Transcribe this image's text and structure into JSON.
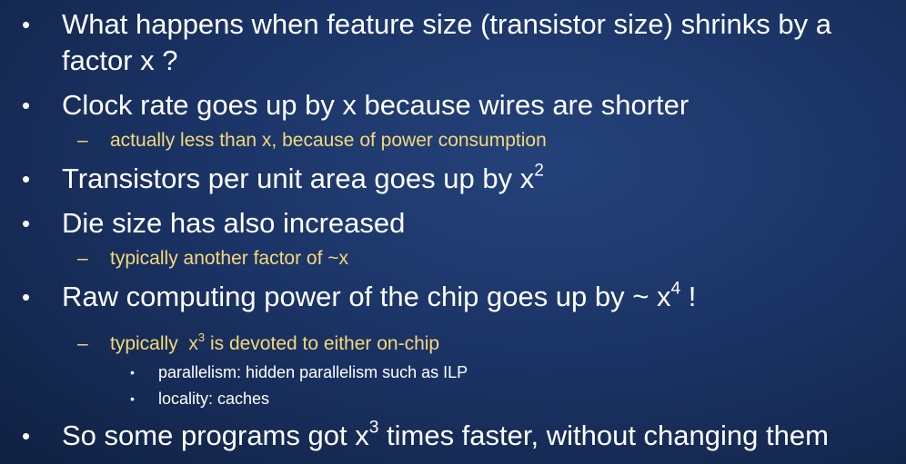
{
  "bullets": {
    "b1": {
      "marker": "•",
      "text": "What happens when feature size (transistor size) shrinks by a factor x ?"
    },
    "b2": {
      "marker": "•",
      "text": "Clock rate goes up by x because wires are shorter"
    },
    "b2a": {
      "marker": "–",
      "text": "actually less than x, because of power consumption"
    },
    "b3": {
      "marker": "•",
      "text_pre": "Transistors per unit area goes up by x",
      "sup": "2",
      "text_post": ""
    },
    "b4": {
      "marker": "•",
      "text": "Die size has also increased"
    },
    "b4a": {
      "marker": "–",
      "text": "typically another factor of ~x"
    },
    "b5": {
      "marker": "•",
      "text_pre": "Raw computing power of the chip goes up by ~ x",
      "sup": "4",
      "text_post": " !"
    },
    "b5a": {
      "marker": "–",
      "text_pre": "typically  x",
      "sup": "3",
      "text_post": " is devoted to either on-chip"
    },
    "b5a1": {
      "marker": "•",
      "text": "parallelism: hidden parallelism such as ILP"
    },
    "b5a2": {
      "marker": "•",
      "text": "locality: caches"
    },
    "b6": {
      "marker": "•",
      "text_pre": "So some programs got x",
      "sup": "3",
      "text_post": " times faster, without changing them"
    }
  }
}
